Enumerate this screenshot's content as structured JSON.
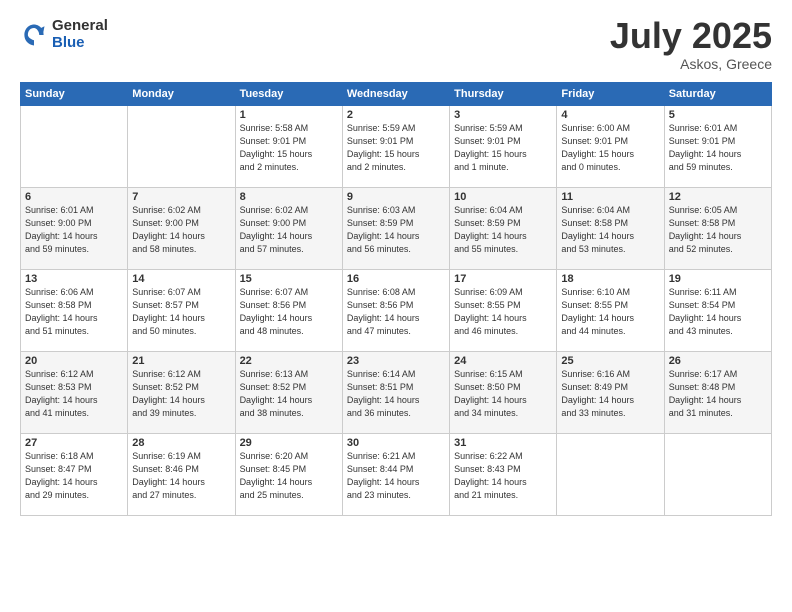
{
  "logo": {
    "general": "General",
    "blue": "Blue"
  },
  "title": "July 2025",
  "subtitle": "Askos, Greece",
  "days_header": [
    "Sunday",
    "Monday",
    "Tuesday",
    "Wednesday",
    "Thursday",
    "Friday",
    "Saturday"
  ],
  "weeks": [
    [
      {
        "day": "",
        "info": ""
      },
      {
        "day": "",
        "info": ""
      },
      {
        "day": "1",
        "info": "Sunrise: 5:58 AM\nSunset: 9:01 PM\nDaylight: 15 hours\nand 2 minutes."
      },
      {
        "day": "2",
        "info": "Sunrise: 5:59 AM\nSunset: 9:01 PM\nDaylight: 15 hours\nand 2 minutes."
      },
      {
        "day": "3",
        "info": "Sunrise: 5:59 AM\nSunset: 9:01 PM\nDaylight: 15 hours\nand 1 minute."
      },
      {
        "day": "4",
        "info": "Sunrise: 6:00 AM\nSunset: 9:01 PM\nDaylight: 15 hours\nand 0 minutes."
      },
      {
        "day": "5",
        "info": "Sunrise: 6:01 AM\nSunset: 9:01 PM\nDaylight: 14 hours\nand 59 minutes."
      }
    ],
    [
      {
        "day": "6",
        "info": "Sunrise: 6:01 AM\nSunset: 9:00 PM\nDaylight: 14 hours\nand 59 minutes."
      },
      {
        "day": "7",
        "info": "Sunrise: 6:02 AM\nSunset: 9:00 PM\nDaylight: 14 hours\nand 58 minutes."
      },
      {
        "day": "8",
        "info": "Sunrise: 6:02 AM\nSunset: 9:00 PM\nDaylight: 14 hours\nand 57 minutes."
      },
      {
        "day": "9",
        "info": "Sunrise: 6:03 AM\nSunset: 8:59 PM\nDaylight: 14 hours\nand 56 minutes."
      },
      {
        "day": "10",
        "info": "Sunrise: 6:04 AM\nSunset: 8:59 PM\nDaylight: 14 hours\nand 55 minutes."
      },
      {
        "day": "11",
        "info": "Sunrise: 6:04 AM\nSunset: 8:58 PM\nDaylight: 14 hours\nand 53 minutes."
      },
      {
        "day": "12",
        "info": "Sunrise: 6:05 AM\nSunset: 8:58 PM\nDaylight: 14 hours\nand 52 minutes."
      }
    ],
    [
      {
        "day": "13",
        "info": "Sunrise: 6:06 AM\nSunset: 8:58 PM\nDaylight: 14 hours\nand 51 minutes."
      },
      {
        "day": "14",
        "info": "Sunrise: 6:07 AM\nSunset: 8:57 PM\nDaylight: 14 hours\nand 50 minutes."
      },
      {
        "day": "15",
        "info": "Sunrise: 6:07 AM\nSunset: 8:56 PM\nDaylight: 14 hours\nand 48 minutes."
      },
      {
        "day": "16",
        "info": "Sunrise: 6:08 AM\nSunset: 8:56 PM\nDaylight: 14 hours\nand 47 minutes."
      },
      {
        "day": "17",
        "info": "Sunrise: 6:09 AM\nSunset: 8:55 PM\nDaylight: 14 hours\nand 46 minutes."
      },
      {
        "day": "18",
        "info": "Sunrise: 6:10 AM\nSunset: 8:55 PM\nDaylight: 14 hours\nand 44 minutes."
      },
      {
        "day": "19",
        "info": "Sunrise: 6:11 AM\nSunset: 8:54 PM\nDaylight: 14 hours\nand 43 minutes."
      }
    ],
    [
      {
        "day": "20",
        "info": "Sunrise: 6:12 AM\nSunset: 8:53 PM\nDaylight: 14 hours\nand 41 minutes."
      },
      {
        "day": "21",
        "info": "Sunrise: 6:12 AM\nSunset: 8:52 PM\nDaylight: 14 hours\nand 39 minutes."
      },
      {
        "day": "22",
        "info": "Sunrise: 6:13 AM\nSunset: 8:52 PM\nDaylight: 14 hours\nand 38 minutes."
      },
      {
        "day": "23",
        "info": "Sunrise: 6:14 AM\nSunset: 8:51 PM\nDaylight: 14 hours\nand 36 minutes."
      },
      {
        "day": "24",
        "info": "Sunrise: 6:15 AM\nSunset: 8:50 PM\nDaylight: 14 hours\nand 34 minutes."
      },
      {
        "day": "25",
        "info": "Sunrise: 6:16 AM\nSunset: 8:49 PM\nDaylight: 14 hours\nand 33 minutes."
      },
      {
        "day": "26",
        "info": "Sunrise: 6:17 AM\nSunset: 8:48 PM\nDaylight: 14 hours\nand 31 minutes."
      }
    ],
    [
      {
        "day": "27",
        "info": "Sunrise: 6:18 AM\nSunset: 8:47 PM\nDaylight: 14 hours\nand 29 minutes."
      },
      {
        "day": "28",
        "info": "Sunrise: 6:19 AM\nSunset: 8:46 PM\nDaylight: 14 hours\nand 27 minutes."
      },
      {
        "day": "29",
        "info": "Sunrise: 6:20 AM\nSunset: 8:45 PM\nDaylight: 14 hours\nand 25 minutes."
      },
      {
        "day": "30",
        "info": "Sunrise: 6:21 AM\nSunset: 8:44 PM\nDaylight: 14 hours\nand 23 minutes."
      },
      {
        "day": "31",
        "info": "Sunrise: 6:22 AM\nSunset: 8:43 PM\nDaylight: 14 hours\nand 21 minutes."
      },
      {
        "day": "",
        "info": ""
      },
      {
        "day": "",
        "info": ""
      }
    ]
  ]
}
